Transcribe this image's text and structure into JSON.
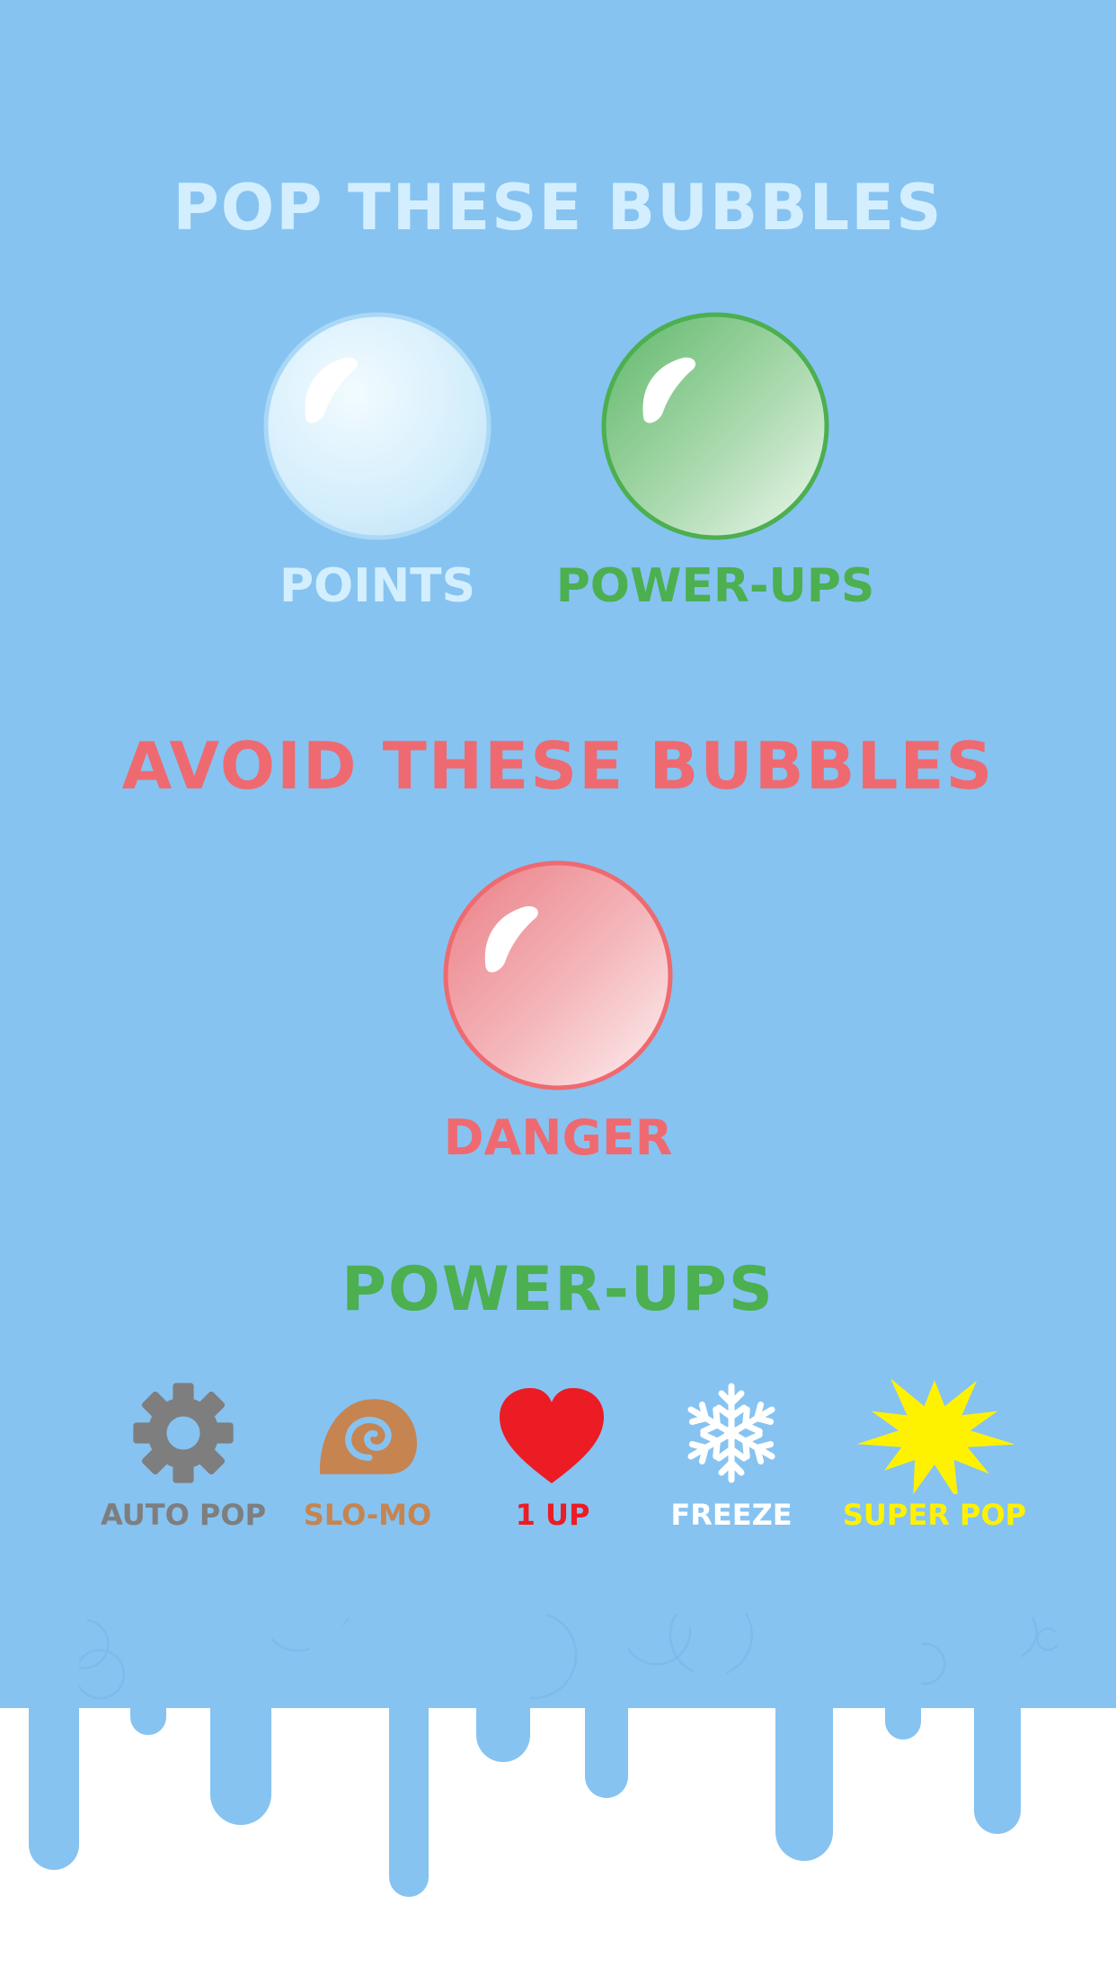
{
  "colors": {
    "background": "#86c3f1",
    "drip": "#86c3f1",
    "pattern": "#78b4e6",
    "pop_heading": "#d3efff",
    "points": "#d3efff",
    "power_ups": "#4caf50",
    "danger": "#ee6a70",
    "auto_pop": "#7e7e7e",
    "slo_mo": "#c68451",
    "one_up": "#ec1c24",
    "freeze": "#ffffff",
    "super_pop": "#fff200"
  },
  "pop_section": {
    "title": "POP THESE BUBBLES",
    "bubbles": [
      {
        "kind": "points",
        "label": "POINTS",
        "icon": "clear-bubble-icon"
      },
      {
        "kind": "power-ups",
        "label": "POWER-UPS",
        "icon": "green-bubble-icon"
      }
    ]
  },
  "avoid_section": {
    "title": "AVOID THESE BUBBLES",
    "bubbles": [
      {
        "kind": "danger",
        "label": "DANGER",
        "icon": "red-bubble-icon"
      }
    ]
  },
  "powerups_section": {
    "title": "POWER-UPS",
    "items": [
      {
        "label": "AUTO POP",
        "icon": "gear-icon"
      },
      {
        "label": "SLO-MO",
        "icon": "snail-shell-icon"
      },
      {
        "label": "1 UP",
        "icon": "heart-icon"
      },
      {
        "label": "FREEZE",
        "icon": "snowflake-icon"
      },
      {
        "label": "SUPER POP",
        "icon": "starburst-icon"
      }
    ]
  }
}
